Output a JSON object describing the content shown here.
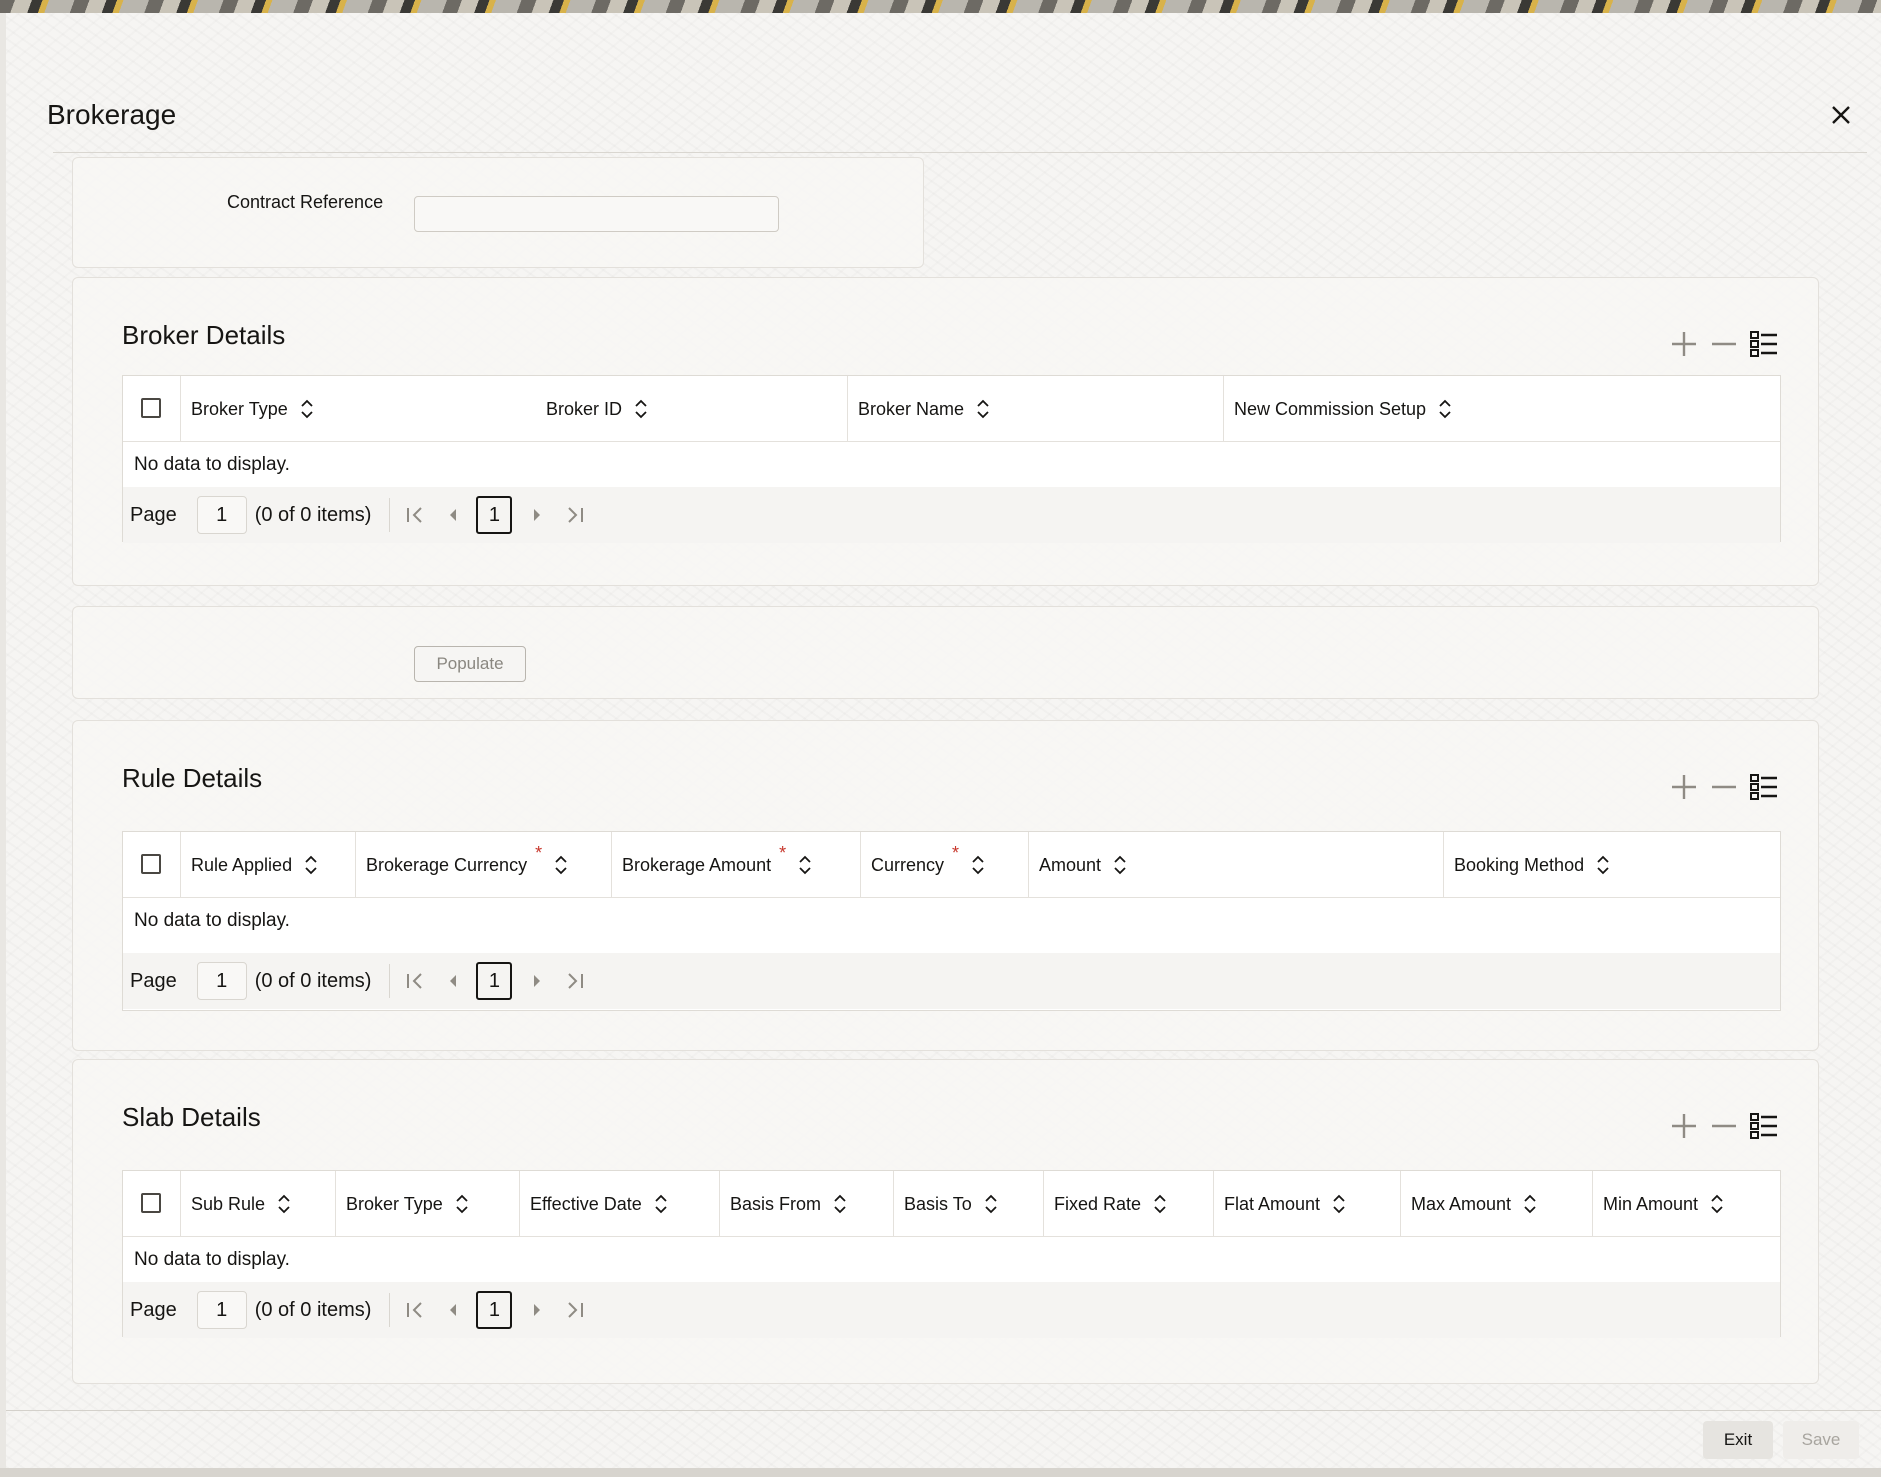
{
  "dialog": {
    "title": "Brokerage"
  },
  "contract": {
    "label": "Contract Reference",
    "value": "",
    "placeholder": ""
  },
  "broker_details": {
    "title": "Broker Details",
    "columns": [
      {
        "label": "Broker Type",
        "required": false
      },
      {
        "label": "Broker ID",
        "required": false
      },
      {
        "label": "Broker Name",
        "required": false
      },
      {
        "label": "New Commission Setup",
        "required": false
      }
    ],
    "empty_text": "No data to display.",
    "pager": {
      "page_label": "Page",
      "page_value": "1",
      "count_text": "(0 of 0 items)",
      "current_page": "1"
    }
  },
  "populate": {
    "label": "Populate"
  },
  "rule_details": {
    "title": "Rule Details",
    "columns": [
      {
        "label": "Rule Applied",
        "required": false
      },
      {
        "label": "Brokerage Currency",
        "required": true
      },
      {
        "label": "Brokerage Amount",
        "required": true
      },
      {
        "label": "Currency",
        "required": true
      },
      {
        "label": "Amount",
        "required": false
      },
      {
        "label": "Booking Method",
        "required": false
      }
    ],
    "empty_text": "No data to display.",
    "pager": {
      "page_label": "Page",
      "page_value": "1",
      "count_text": "(0 of 0 items)",
      "current_page": "1"
    }
  },
  "slab_details": {
    "title": "Slab Details",
    "columns": [
      {
        "label": "Sub Rule",
        "required": false
      },
      {
        "label": "Broker Type",
        "required": false
      },
      {
        "label": "Effective Date",
        "required": false
      },
      {
        "label": "Basis From",
        "required": false
      },
      {
        "label": "Basis To",
        "required": false
      },
      {
        "label": "Fixed Rate",
        "required": false
      },
      {
        "label": "Flat Amount",
        "required": false
      },
      {
        "label": "Max Amount",
        "required": false
      },
      {
        "label": "Min Amount",
        "required": false
      }
    ],
    "empty_text": "No data to display.",
    "pager": {
      "page_label": "Page",
      "page_value": "1",
      "count_text": "(0 of 0 items)",
      "current_page": "1"
    }
  },
  "footer": {
    "exit_label": "Exit",
    "save_label": "Save"
  },
  "required_marker": "*",
  "icons": {
    "close": "close-icon",
    "add_row": "plus-icon",
    "delete_row": "minus-icon",
    "single_view": "list-view-icon",
    "sort": "sort-icon",
    "first_page": "first-page-icon",
    "prev_page": "prev-page-icon",
    "next_page": "next-page-icon",
    "last_page": "last-page-icon"
  },
  "colors": {
    "accent_required": "#c7362b",
    "text": "#161513",
    "disabled_text": "#8a8780"
  }
}
